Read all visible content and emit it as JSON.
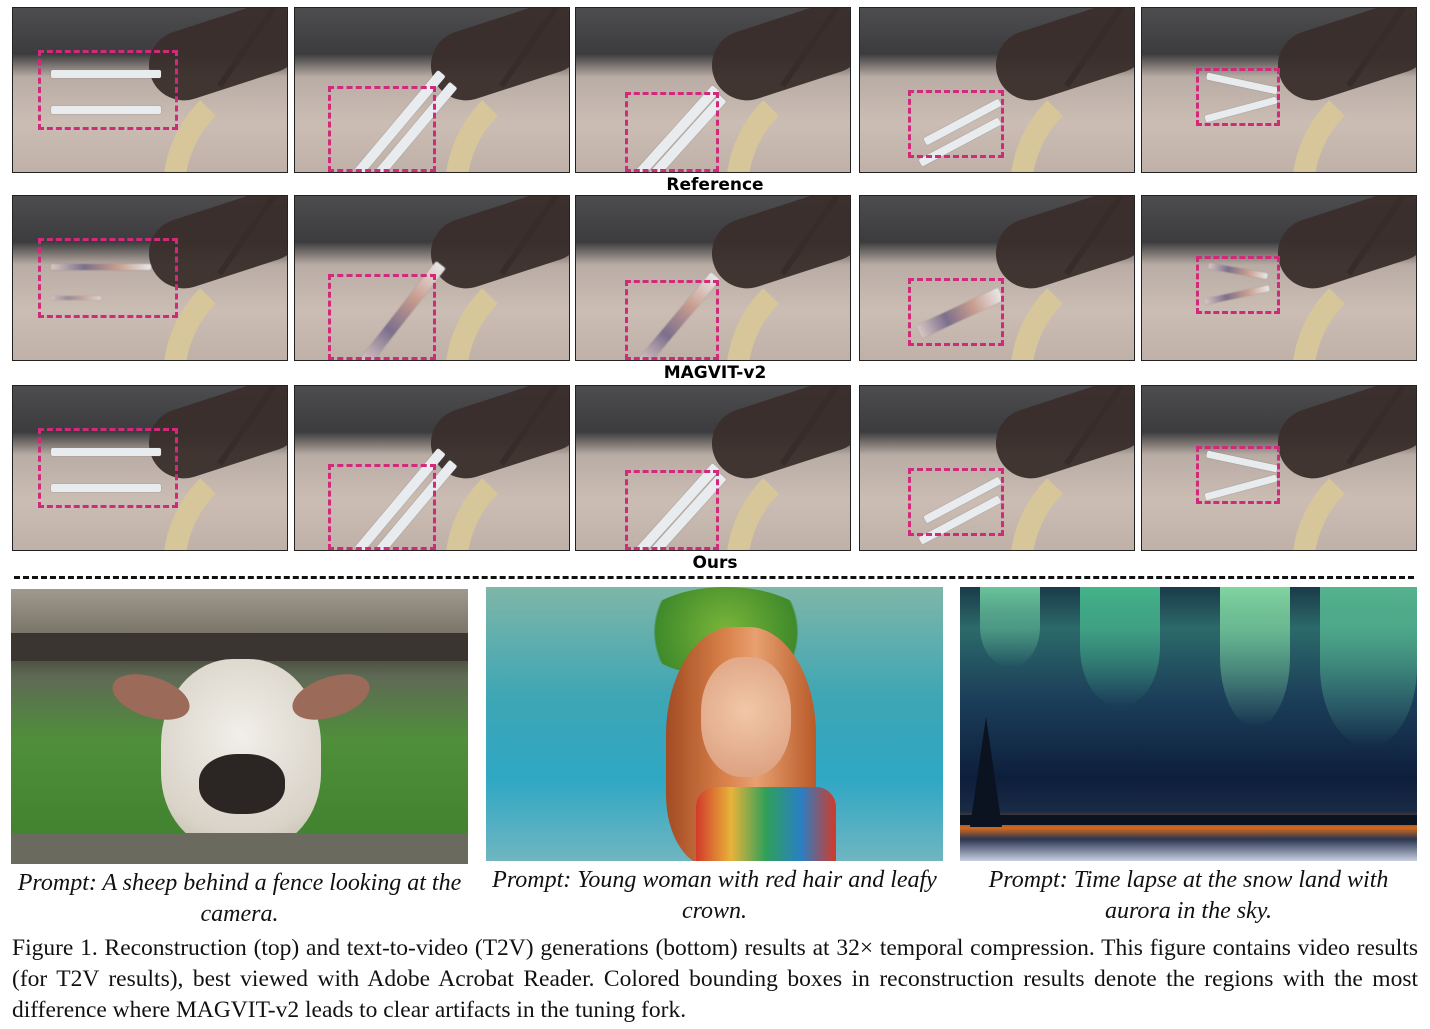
{
  "rows": [
    {
      "label": "Reference"
    },
    {
      "label": "MAGVIT-v2"
    },
    {
      "label": "Ours"
    }
  ],
  "colors": {
    "bounding_box": "#d12a7a",
    "aurora_green": "#4fd39a",
    "sky_dark": "#0d1e3c"
  },
  "generations": [
    {
      "caption": "Prompt: A sheep behind a fence looking at the camera."
    },
    {
      "caption": "Prompt: Young woman with red hair and leafy crown."
    },
    {
      "caption": "Prompt: Time lapse at the snow land with aurora in the sky."
    }
  ],
  "figure_caption": "Figure 1. Reconstruction (top) and text-to-video (T2V) generations (bottom) results at 32× temporal compression. This figure contains video results (for T2V results), best viewed with Adobe Acrobat Reader. Colored bounding boxes in reconstruction results denote the regions with the most difference where MAGVIT-v2 leads to clear artifacts in the tuning fork."
}
